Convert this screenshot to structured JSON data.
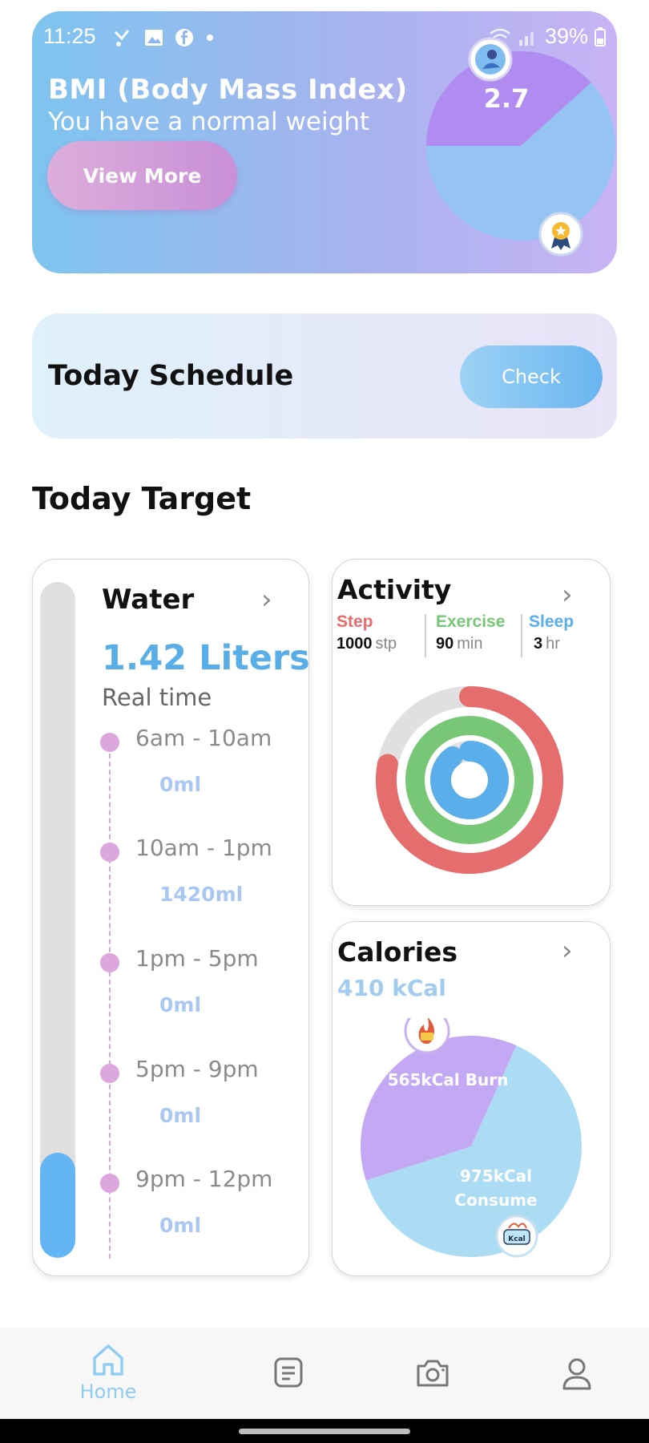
{
  "status_bar": {
    "time": "11:25",
    "battery": "39%"
  },
  "bmi": {
    "title": "BMI (Body Mass Index)",
    "subtitle": "You have a normal weight",
    "view_more_label": "View More",
    "value": "2.7",
    "colors": {
      "slice": "#b08cf0",
      "rest": "#96c4f2"
    }
  },
  "schedule": {
    "title": "Today Schedule",
    "check_label": "Check"
  },
  "today_target": {
    "title": "Today Target"
  },
  "water": {
    "title": "Water",
    "amount": "1.42 Liters",
    "subtitle": "Real time",
    "fill_fraction": 0.155,
    "timeline": [
      {
        "range": "6am - 10am",
        "amount": "0ml"
      },
      {
        "range": "10am - 1pm",
        "amount": "1420ml"
      },
      {
        "range": "1pm - 5pm",
        "amount": "0ml"
      },
      {
        "range": "5pm - 9pm",
        "amount": "0ml"
      },
      {
        "range": "9pm - 12pm",
        "amount": "0ml"
      }
    ]
  },
  "activity": {
    "title": "Activity",
    "step": {
      "label": "Step",
      "value": "1000",
      "unit": "stp",
      "color": "#e56d6d",
      "ring_fraction": 0.78
    },
    "exercise": {
      "label": "Exercise",
      "value": "90",
      "unit": "min",
      "color": "#77c777",
      "ring_fraction": 1.0
    },
    "sleep": {
      "label": "Sleep",
      "value": "3",
      "unit": "hr",
      "color": "#5aaeea",
      "ring_fraction": 0.9
    }
  },
  "calories": {
    "title": "Calories",
    "value": "410 kCal",
    "burn_label": "565kCal Burn",
    "consume_label_1": "975kCal",
    "consume_label_2": "Consume",
    "burn": 565,
    "consume": 975,
    "colors": {
      "burn": "#c3a8f3",
      "consume": "#abdcf3"
    },
    "kcal_badge": "Kcal"
  },
  "nav": {
    "home_label": "Home"
  }
}
